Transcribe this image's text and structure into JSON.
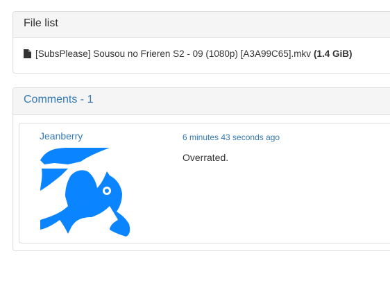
{
  "file_list": {
    "heading": "File list",
    "files": [
      {
        "name": "[SubsPlease] Sousou no Frieren S2 - 09 (1080p) [A3A99C65].mkv",
        "size": "(1.4 GiB)",
        "icon": "file-icon"
      }
    ]
  },
  "comments": {
    "heading": "Comments - 1",
    "items": [
      {
        "username": "Jeanberry",
        "timestamp": "6 minutes 43 seconds ago",
        "text": "Overrated.",
        "avatar_color": "#0b84ff"
      }
    ]
  }
}
